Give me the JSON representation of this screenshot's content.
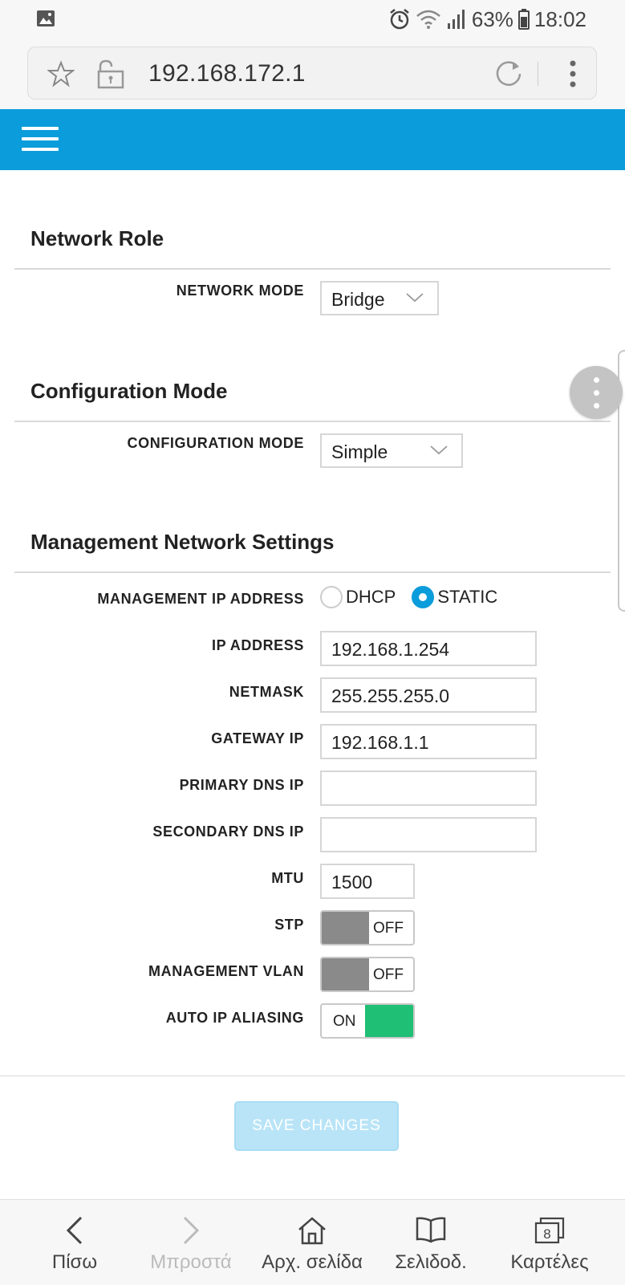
{
  "status_bar": {
    "battery": "63%",
    "time": "18:02"
  },
  "browser": {
    "url": "192.168.172.1"
  },
  "sections": {
    "network_role": {
      "title": "Network Role",
      "network_mode_label": "NETWORK MODE",
      "network_mode_value": "Bridge"
    },
    "configuration_mode": {
      "title": "Configuration Mode",
      "config_mode_label": "CONFIGURATION MODE",
      "config_mode_value": "Simple"
    },
    "management": {
      "title": "Management Network Settings",
      "mgmt_ip_label": "MANAGEMENT IP ADDRESS",
      "dhcp_label": "DHCP",
      "static_label": "STATIC",
      "selected": "STATIC",
      "ip_label": "IP ADDRESS",
      "ip_value": "192.168.1.254",
      "netmask_label": "NETMASK",
      "netmask_value": "255.255.255.0",
      "gateway_label": "GATEWAY IP",
      "gateway_value": "192.168.1.1",
      "primary_dns_label": "PRIMARY DNS IP",
      "primary_dns_value": "",
      "secondary_dns_label": "SECONDARY DNS IP",
      "secondary_dns_value": "",
      "mtu_label": "MTU",
      "mtu_value": "1500",
      "stp_label": "STP",
      "stp_state": "OFF",
      "vlan_label": "MANAGEMENT VLAN",
      "vlan_state": "OFF",
      "alias_label": "AUTO IP ALIASING",
      "alias_state": "ON"
    }
  },
  "save_button": "SAVE CHANGES",
  "bottom_nav": {
    "back": "Πίσω",
    "forward": "Μπροστά",
    "home": "Αρχ. σελίδα",
    "bookmarks": "Σελιδοδ.",
    "tabs": "Καρτέλες",
    "tab_count": "8"
  },
  "colors": {
    "header": "#0b9cdb",
    "accent": "#0b9cdb",
    "toggle_on": "#1fbf75",
    "toggle_off": "#8a8a8a",
    "save_disabled": "#b9e4f7"
  }
}
